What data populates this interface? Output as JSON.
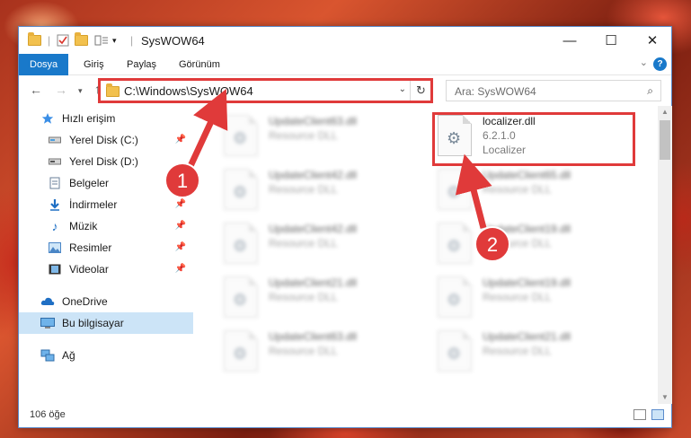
{
  "window": {
    "title": "SysWOW64",
    "controls": {
      "minimize": "—",
      "maximize": "☐",
      "close": "✕"
    }
  },
  "ribbon": {
    "tabs": [
      {
        "label": "Dosya",
        "active": true
      },
      {
        "label": "Giriş"
      },
      {
        "label": "Paylaş"
      },
      {
        "label": "Görünüm"
      }
    ],
    "help": "?"
  },
  "nav": {
    "address": "C:\\Windows\\SysWOW64",
    "search_placeholder": "Ara: SysWOW64"
  },
  "sidebar": {
    "items": [
      {
        "label": "Hızlı erişim",
        "icon": "star-icon"
      },
      {
        "label": "Yerel Disk (C:)",
        "icon": "drive-icon",
        "pinned": true
      },
      {
        "label": "Yerel Disk (D:)",
        "icon": "drive-icon"
      },
      {
        "label": "Belgeler",
        "icon": "document-icon"
      },
      {
        "label": "İndirmeler",
        "icon": "download-icon",
        "pinned": true
      },
      {
        "label": "Müzik",
        "icon": "music-icon",
        "pinned": true
      },
      {
        "label": "Resimler",
        "icon": "pictures-icon",
        "pinned": true
      },
      {
        "label": "Videolar",
        "icon": "video-icon",
        "pinned": true
      },
      {
        "label": "OneDrive",
        "icon": "cloud-icon"
      },
      {
        "label": "Bu bilgisayar",
        "icon": "computer-icon",
        "selected": true
      },
      {
        "label": "Ağ",
        "icon": "network-icon"
      }
    ]
  },
  "files": {
    "highlighted": {
      "name": "localizer.dll",
      "version": "6.2.1.0",
      "description": "Localizer"
    },
    "left_column": [
      {
        "name": "UpdateClient63.dll",
        "type": "Resource DLL"
      },
      {
        "name": "UpdateClient42.dll",
        "type": "Resource DLL"
      },
      {
        "name": "UpdateClient42.dll",
        "type": "Resource DLL"
      },
      {
        "name": "UpdateClient21.dll",
        "type": "Resource DLL"
      },
      {
        "name": "UpdateClient63.dll",
        "type": "Resource DLL"
      }
    ],
    "right_column": [
      {
        "name": "UpdateClient65.dll",
        "type": "Resource DLL"
      },
      {
        "name": "UpdateClient19.dll",
        "type": "Resource DLL"
      },
      {
        "name": "UpdateClient19.dll",
        "type": "Resource DLL"
      },
      {
        "name": "UpdateClient21.dll",
        "type": "Resource DLL"
      }
    ]
  },
  "status": {
    "count": "106 öğe"
  },
  "annotations": {
    "marker1": "1",
    "marker2": "2",
    "color": "#e03a3a"
  }
}
